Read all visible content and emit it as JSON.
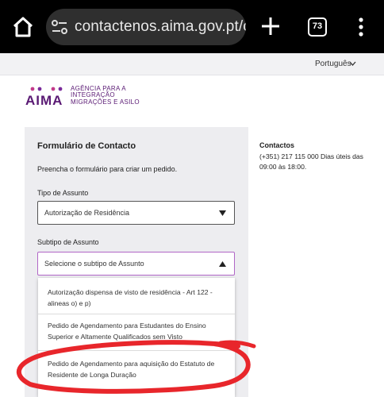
{
  "browser": {
    "url": "contactenos.aima.gov.pt/co",
    "tab_count": "73"
  },
  "language": {
    "label": "Português"
  },
  "logo": {
    "mark": "AIMA",
    "line1": "AGÊNCIA PARA A",
    "line2": "INTEGRAÇÃO",
    "line3": "MIGRAÇÕES E ASILO",
    "color": "#5a1a74"
  },
  "form": {
    "title": "Formulário de Contacto",
    "instructions": "Preencha o formulário para criar um pedido.",
    "type_label": "Tipo de Assunto",
    "type_value": "Autorização de Residência",
    "subtype_label": "Subtipo de Assunto",
    "subtype_placeholder": "Selecione o subtipo de Assunto",
    "subtype_options": [
      "Autorização dispensa de visto de residência - Art 122 - alineas o) e p)",
      "Pedido de Agendamento para Estudantes do Ensino Superior e Altamente Qualificados sem Visto",
      "Pedido de Agendamento para aquisição do Estatuto de Residente de Longa Duração"
    ]
  },
  "contacts": {
    "title": "Contactos",
    "body": "(+351) 217 115 000 Dias úteis das 09:00 às 18:00."
  },
  "colors": {
    "chrome": "#000000",
    "accent_purple": "#b166c6",
    "annotation_red": "#e8262b"
  }
}
